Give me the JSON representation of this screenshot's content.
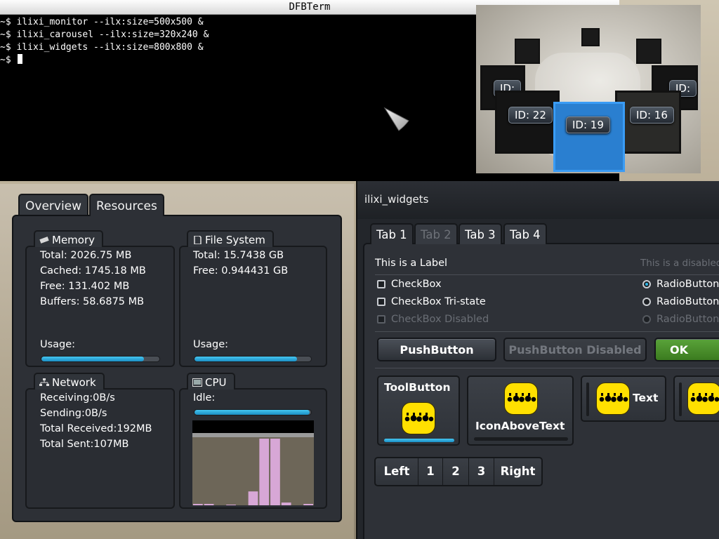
{
  "terminal": {
    "title": "DFBTerm",
    "lines": [
      "~$ ilixi_monitor --ilx:size=500x500 &",
      "~$ ilixi_carousel --ilx:size=320x240 &",
      "~$ ilixi_widgets --ilx:size=800x800 &",
      "~$ "
    ]
  },
  "carousel": {
    "cards": [
      "ID: 22",
      "ID: 19",
      "ID: 16"
    ],
    "partial_cards": [
      "ID:",
      "ID:"
    ],
    "selected": "ID: 19"
  },
  "monitor": {
    "tabs": [
      "Overview",
      "Resources"
    ],
    "active_tab": "Resources",
    "memory": {
      "title": "Memory",
      "total": "Total: 2026.75 MB",
      "cached": "Cached: 1745.18 MB",
      "free": "Free: 131.402 MB",
      "buffers": "Buffers: 58.6875 MB",
      "usage_label": "Usage:",
      "usage": 0.87
    },
    "filesystem": {
      "title": "File System",
      "total": "Total: 15.7438 GB",
      "free": "Free: 0.944431 GB",
      "usage_label": "Usage:",
      "usage": 0.88
    },
    "network": {
      "title": "Network",
      "receiving": "Receiving:0B/s",
      "sending": "Sending:0B/s",
      "total_received": "Total Received:192MB",
      "total_sent": "Total Sent:107MB"
    },
    "cpu": {
      "title": "CPU",
      "idle_label": "Idle:",
      "idle": 0.99,
      "histogram": [
        0.02,
        0.02,
        0.0,
        0.01,
        0.0,
        0.2,
        0.96,
        0.96,
        0.04,
        0.0,
        0.02
      ]
    }
  },
  "widgets": {
    "title": "ilixi_widgets",
    "tabs": [
      {
        "label": "Tab 1",
        "state": "active"
      },
      {
        "label": "Tab 2",
        "state": "disabled"
      },
      {
        "label": "Tab 3",
        "state": "normal"
      },
      {
        "label": "Tab 4",
        "state": "normal"
      }
    ],
    "label": "This is a Label",
    "disabled_label": "This is a disabled",
    "checkboxes": [
      "CheckBox",
      "CheckBox Tri-state",
      "CheckBox Disabled"
    ],
    "radios": [
      "RadioButton",
      "RadioButton",
      "RadioButton"
    ],
    "buttons": {
      "push": "PushButton",
      "push_disabled": "PushButton Disabled",
      "ok": "OK"
    },
    "toolbuttons": {
      "tool": "ToolButton",
      "icon_above": "IconAboveText",
      "text": "Text"
    },
    "spinner": [
      "Left",
      "1",
      "2",
      "3",
      "Right"
    ],
    "colors": {
      "accent": "#2bb7ea",
      "ok_green": "#4a9a2c",
      "logo_yellow": "#ffe000"
    }
  }
}
